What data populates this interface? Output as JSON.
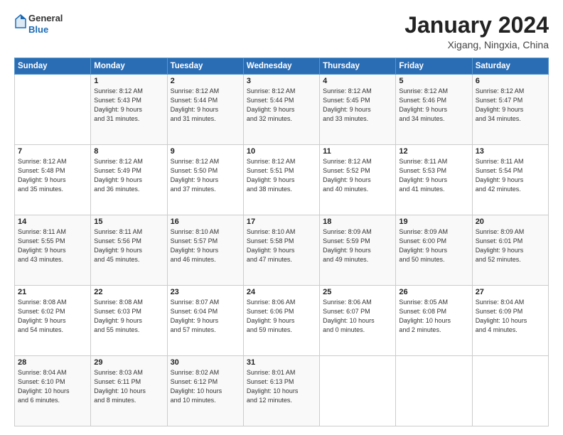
{
  "header": {
    "logo": {
      "line1": "General",
      "line2": "Blue"
    },
    "title": "January 2024",
    "location": "Xigang, Ningxia, China"
  },
  "weekdays": [
    "Sunday",
    "Monday",
    "Tuesday",
    "Wednesday",
    "Thursday",
    "Friday",
    "Saturday"
  ],
  "weeks": [
    [
      {
        "day": "",
        "info": ""
      },
      {
        "day": "1",
        "info": "Sunrise: 8:12 AM\nSunset: 5:43 PM\nDaylight: 9 hours\nand 31 minutes."
      },
      {
        "day": "2",
        "info": "Sunrise: 8:12 AM\nSunset: 5:44 PM\nDaylight: 9 hours\nand 31 minutes."
      },
      {
        "day": "3",
        "info": "Sunrise: 8:12 AM\nSunset: 5:44 PM\nDaylight: 9 hours\nand 32 minutes."
      },
      {
        "day": "4",
        "info": "Sunrise: 8:12 AM\nSunset: 5:45 PM\nDaylight: 9 hours\nand 33 minutes."
      },
      {
        "day": "5",
        "info": "Sunrise: 8:12 AM\nSunset: 5:46 PM\nDaylight: 9 hours\nand 34 minutes."
      },
      {
        "day": "6",
        "info": "Sunrise: 8:12 AM\nSunset: 5:47 PM\nDaylight: 9 hours\nand 34 minutes."
      }
    ],
    [
      {
        "day": "7",
        "info": "Sunrise: 8:12 AM\nSunset: 5:48 PM\nDaylight: 9 hours\nand 35 minutes."
      },
      {
        "day": "8",
        "info": "Sunrise: 8:12 AM\nSunset: 5:49 PM\nDaylight: 9 hours\nand 36 minutes."
      },
      {
        "day": "9",
        "info": "Sunrise: 8:12 AM\nSunset: 5:50 PM\nDaylight: 9 hours\nand 37 minutes."
      },
      {
        "day": "10",
        "info": "Sunrise: 8:12 AM\nSunset: 5:51 PM\nDaylight: 9 hours\nand 38 minutes."
      },
      {
        "day": "11",
        "info": "Sunrise: 8:12 AM\nSunset: 5:52 PM\nDaylight: 9 hours\nand 40 minutes."
      },
      {
        "day": "12",
        "info": "Sunrise: 8:11 AM\nSunset: 5:53 PM\nDaylight: 9 hours\nand 41 minutes."
      },
      {
        "day": "13",
        "info": "Sunrise: 8:11 AM\nSunset: 5:54 PM\nDaylight: 9 hours\nand 42 minutes."
      }
    ],
    [
      {
        "day": "14",
        "info": "Sunrise: 8:11 AM\nSunset: 5:55 PM\nDaylight: 9 hours\nand 43 minutes."
      },
      {
        "day": "15",
        "info": "Sunrise: 8:11 AM\nSunset: 5:56 PM\nDaylight: 9 hours\nand 45 minutes."
      },
      {
        "day": "16",
        "info": "Sunrise: 8:10 AM\nSunset: 5:57 PM\nDaylight: 9 hours\nand 46 minutes."
      },
      {
        "day": "17",
        "info": "Sunrise: 8:10 AM\nSunset: 5:58 PM\nDaylight: 9 hours\nand 47 minutes."
      },
      {
        "day": "18",
        "info": "Sunrise: 8:09 AM\nSunset: 5:59 PM\nDaylight: 9 hours\nand 49 minutes."
      },
      {
        "day": "19",
        "info": "Sunrise: 8:09 AM\nSunset: 6:00 PM\nDaylight: 9 hours\nand 50 minutes."
      },
      {
        "day": "20",
        "info": "Sunrise: 8:09 AM\nSunset: 6:01 PM\nDaylight: 9 hours\nand 52 minutes."
      }
    ],
    [
      {
        "day": "21",
        "info": "Sunrise: 8:08 AM\nSunset: 6:02 PM\nDaylight: 9 hours\nand 54 minutes."
      },
      {
        "day": "22",
        "info": "Sunrise: 8:08 AM\nSunset: 6:03 PM\nDaylight: 9 hours\nand 55 minutes."
      },
      {
        "day": "23",
        "info": "Sunrise: 8:07 AM\nSunset: 6:04 PM\nDaylight: 9 hours\nand 57 minutes."
      },
      {
        "day": "24",
        "info": "Sunrise: 8:06 AM\nSunset: 6:06 PM\nDaylight: 9 hours\nand 59 minutes."
      },
      {
        "day": "25",
        "info": "Sunrise: 8:06 AM\nSunset: 6:07 PM\nDaylight: 10 hours\nand 0 minutes."
      },
      {
        "day": "26",
        "info": "Sunrise: 8:05 AM\nSunset: 6:08 PM\nDaylight: 10 hours\nand 2 minutes."
      },
      {
        "day": "27",
        "info": "Sunrise: 8:04 AM\nSunset: 6:09 PM\nDaylight: 10 hours\nand 4 minutes."
      }
    ],
    [
      {
        "day": "28",
        "info": "Sunrise: 8:04 AM\nSunset: 6:10 PM\nDaylight: 10 hours\nand 6 minutes."
      },
      {
        "day": "29",
        "info": "Sunrise: 8:03 AM\nSunset: 6:11 PM\nDaylight: 10 hours\nand 8 minutes."
      },
      {
        "day": "30",
        "info": "Sunrise: 8:02 AM\nSunset: 6:12 PM\nDaylight: 10 hours\nand 10 minutes."
      },
      {
        "day": "31",
        "info": "Sunrise: 8:01 AM\nSunset: 6:13 PM\nDaylight: 10 hours\nand 12 minutes."
      },
      {
        "day": "",
        "info": ""
      },
      {
        "day": "",
        "info": ""
      },
      {
        "day": "",
        "info": ""
      }
    ]
  ]
}
